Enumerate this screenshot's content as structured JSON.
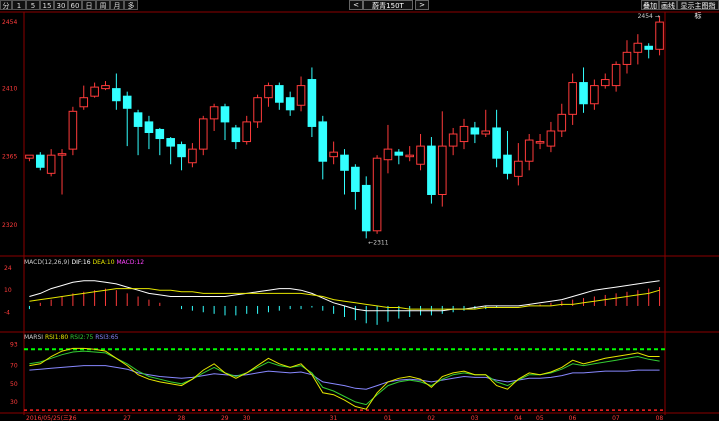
{
  "toolbar": {
    "periods": [
      "分",
      "1",
      "5",
      "15",
      "30",
      "60",
      "日",
      "周",
      "月",
      "多"
    ],
    "prev": "<",
    "next": ">",
    "title": "蔚青150T",
    "right_buttons": [
      "叠加",
      "画线",
      "显示主图指标",
      ">>"
    ]
  },
  "price_axis": {
    "ticks": [
      "2454",
      "2410",
      "2365",
      "2320"
    ]
  },
  "annotations": {
    "high": "2454",
    "low": "2311"
  },
  "macd": {
    "title": "MACD(12,26,9)",
    "dif": "DIF:16",
    "dea": "DEA:10",
    "macd": "MACD:12",
    "ticks": [
      "24",
      "10",
      "-4"
    ]
  },
  "rsi": {
    "title": "MARSI",
    "rsi1": "RSI1:80",
    "rsi2": "RSI2:75",
    "rsi3": "RSI3:65",
    "ticks": [
      "93",
      "70",
      "50",
      "30"
    ]
  },
  "date_axis": {
    "labels": [
      "2016/05/25(三)",
      "26",
      "27",
      "28",
      "29",
      "30",
      "31",
      "01",
      "02",
      "03",
      "04",
      "05",
      "06",
      "07",
      "08"
    ]
  },
  "colors": {
    "up": "#ff3b3b",
    "down": "#33ffff",
    "dif": "#ffffff",
    "dea": "#e6e600",
    "macd": "#ff44ff",
    "rsi1": "#e6e600",
    "rsi2": "#33cc33",
    "rsi3": "#8888ff"
  },
  "chart_data": {
    "type": "candlestick",
    "ylim": [
      2300,
      2460
    ],
    "candles": [
      [
        2364,
        2366,
        2362,
        2365
      ],
      [
        2366,
        2358,
        2356,
        2368
      ],
      [
        2354,
        2366,
        2352,
        2370
      ],
      [
        2366,
        2367,
        2340,
        2370
      ],
      [
        2370,
        2395,
        2366,
        2398
      ],
      [
        2398,
        2404,
        2396,
        2412
      ],
      [
        2405,
        2411,
        2404,
        2414
      ],
      [
        2410,
        2412,
        2409,
        2415
      ],
      [
        2410,
        2402,
        2396,
        2420
      ],
      [
        2405,
        2397,
        2372,
        2408
      ],
      [
        2394,
        2385,
        2366,
        2396
      ],
      [
        2388,
        2381,
        2370,
        2392
      ],
      [
        2383,
        2377,
        2366,
        2384
      ],
      [
        2377,
        2372,
        2360,
        2378
      ],
      [
        2373,
        2365,
        2356,
        2375
      ],
      [
        2361,
        2370,
        2358,
        2374
      ],
      [
        2370,
        2390,
        2366,
        2392
      ],
      [
        2390,
        2398,
        2382,
        2400
      ],
      [
        2398,
        2388,
        2376,
        2400
      ],
      [
        2384,
        2375,
        2370,
        2386
      ],
      [
        2375,
        2388,
        2373,
        2392
      ],
      [
        2388,
        2404,
        2384,
        2406
      ],
      [
        2404,
        2412,
        2398,
        2414
      ],
      [
        2412,
        2401,
        2396,
        2414
      ],
      [
        2404,
        2396,
        2392,
        2408
      ],
      [
        2399,
        2412,
        2395,
        2418
      ],
      [
        2416,
        2385,
        2378,
        2424
      ],
      [
        2388,
        2362,
        2350,
        2392
      ],
      [
        2365,
        2368,
        2360,
        2375
      ],
      [
        2366,
        2356,
        2340,
        2370
      ],
      [
        2358,
        2342,
        2330,
        2360
      ],
      [
        2346,
        2316,
        2311,
        2352
      ],
      [
        2316,
        2364,
        2314,
        2366
      ],
      [
        2363,
        2370,
        2354,
        2386
      ],
      [
        2368,
        2366,
        2360,
        2370
      ],
      [
        2365,
        2366,
        2362,
        2372
      ],
      [
        2360,
        2372,
        2356,
        2380
      ],
      [
        2372,
        2340,
        2334,
        2378
      ],
      [
        2340,
        2372,
        2332,
        2395
      ],
      [
        2372,
        2380,
        2366,
        2384
      ],
      [
        2375,
        2385,
        2370,
        2390
      ],
      [
        2384,
        2380,
        2374,
        2388
      ],
      [
        2380,
        2382,
        2378,
        2396
      ],
      [
        2384,
        2364,
        2358,
        2396
      ],
      [
        2366,
        2354,
        2350,
        2382
      ],
      [
        2352,
        2362,
        2346,
        2374
      ],
      [
        2362,
        2376,
        2356,
        2380
      ],
      [
        2374,
        2375,
        2370,
        2380
      ],
      [
        2372,
        2382,
        2368,
        2388
      ],
      [
        2382,
        2393,
        2378,
        2400
      ],
      [
        2393,
        2414,
        2386,
        2420
      ],
      [
        2414,
        2400,
        2394,
        2424
      ],
      [
        2400,
        2412,
        2396,
        2416
      ],
      [
        2412,
        2416,
        2410,
        2420
      ],
      [
        2412,
        2426,
        2408,
        2428
      ],
      [
        2426,
        2434,
        2420,
        2442
      ],
      [
        2434,
        2440,
        2426,
        2446
      ],
      [
        2438,
        2436,
        2430,
        2440
      ],
      [
        2436,
        2454,
        2432,
        2458
      ]
    ],
    "macd_hist": [
      -2,
      2,
      4,
      6,
      8,
      9,
      10,
      11,
      10,
      8,
      6,
      4,
      2,
      0,
      -2,
      -3,
      -4,
      -5,
      -6,
      -6,
      -5,
      -5,
      -4,
      -3,
      -2,
      -2,
      -1,
      -3,
      -5,
      -7,
      -9,
      -11,
      -12,
      -10,
      -8,
      -7,
      -6,
      -6,
      -5,
      -4,
      -3,
      -2,
      -2,
      -1,
      0,
      0,
      1,
      1,
      2,
      3,
      4,
      5,
      6,
      7,
      8,
      9,
      10,
      11,
      12
    ],
    "dif": [
      6,
      8,
      11,
      13,
      15,
      16,
      16,
      15,
      14,
      12,
      10,
      8,
      7,
      6,
      6,
      6,
      6,
      6,
      6,
      7,
      8,
      9,
      10,
      11,
      11,
      10,
      8,
      5,
      2,
      0,
      -2,
      -3,
      -3,
      -3,
      -3,
      -3,
      -3,
      -3,
      -3,
      -2,
      -2,
      -1,
      0,
      0,
      0,
      0,
      1,
      2,
      3,
      4,
      6,
      8,
      10,
      11,
      12,
      13,
      14,
      15,
      16
    ],
    "dea": [
      3,
      4,
      5,
      6,
      7,
      8,
      9,
      10,
      11,
      11,
      11,
      11,
      10,
      10,
      9,
      9,
      8,
      8,
      8,
      8,
      8,
      8,
      8,
      8,
      8,
      8,
      7,
      6,
      4,
      3,
      2,
      1,
      0,
      -1,
      -1,
      -2,
      -2,
      -2,
      -2,
      -2,
      -2,
      -2,
      -1,
      -1,
      -1,
      -1,
      0,
      0,
      0,
      1,
      1,
      2,
      3,
      4,
      5,
      6,
      7,
      8,
      10
    ],
    "rsi1": [
      70,
      72,
      80,
      86,
      89,
      89,
      88,
      86,
      78,
      70,
      60,
      55,
      52,
      50,
      48,
      55,
      65,
      72,
      62,
      56,
      62,
      70,
      78,
      72,
      68,
      72,
      60,
      40,
      38,
      32,
      25,
      22,
      40,
      52,
      56,
      58,
      55,
      46,
      58,
      62,
      64,
      60,
      60,
      48,
      44,
      55,
      62,
      60,
      63,
      68,
      76,
      72,
      75,
      78,
      80,
      82,
      84,
      80,
      80
    ],
    "rsi2": [
      72,
      74,
      78,
      82,
      85,
      86,
      85,
      84,
      78,
      72,
      64,
      58,
      55,
      52,
      50,
      55,
      62,
      68,
      62,
      58,
      62,
      68,
      74,
      70,
      68,
      70,
      62,
      46,
      42,
      36,
      30,
      27,
      38,
      48,
      52,
      54,
      52,
      48,
      55,
      60,
      62,
      60,
      60,
      52,
      48,
      54,
      60,
      60,
      62,
      66,
      72,
      70,
      72,
      74,
      76,
      78,
      80,
      77,
      75
    ],
    "rsi3": [
      65,
      66,
      67,
      68,
      69,
      70,
      70,
      70,
      68,
      66,
      62,
      60,
      58,
      57,
      56,
      57,
      59,
      61,
      60,
      59,
      60,
      62,
      64,
      63,
      62,
      63,
      60,
      52,
      50,
      48,
      45,
      44,
      48,
      52,
      54,
      55,
      54,
      52,
      54,
      56,
      58,
      57,
      57,
      54,
      52,
      54,
      56,
      56,
      57,
      59,
      62,
      62,
      63,
      64,
      64,
      64,
      65,
      65,
      65
    ],
    "rsi_ylim": [
      20,
      96
    ]
  }
}
